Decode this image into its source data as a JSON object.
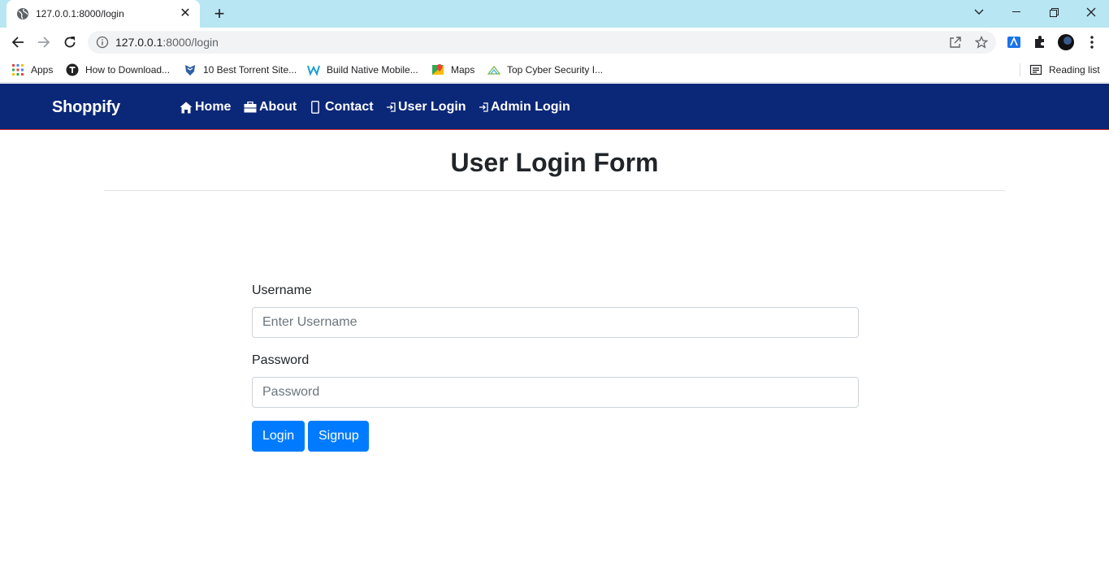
{
  "browser": {
    "tab_title": "127.0.0.1:8000/login",
    "url_host": "127.0.0.1",
    "url_rest": ":8000/login",
    "bookmarks": [
      {
        "label": "Apps"
      },
      {
        "label": "How to Download..."
      },
      {
        "label": "10 Best Torrent Site..."
      },
      {
        "label": "Build Native Mobile..."
      },
      {
        "label": "Maps"
      },
      {
        "label": "Top Cyber Security I..."
      }
    ],
    "reading_list": "Reading list"
  },
  "navbar": {
    "brand": "Shoppify",
    "links": [
      {
        "label": "Home",
        "icon": "home-icon"
      },
      {
        "label": "About",
        "icon": "briefcase-icon"
      },
      {
        "label": "Contact",
        "icon": "phone-icon"
      },
      {
        "label": "User Login",
        "icon": "sign-in-icon"
      },
      {
        "label": "Admin Login",
        "icon": "sign-in-icon"
      }
    ],
    "color": "#0b2777"
  },
  "page": {
    "heading": "User Login Form",
    "username_label": "Username",
    "username_placeholder": "Enter Username",
    "password_label": "Password",
    "password_placeholder": "Password",
    "login_button": "Login",
    "signup_button": "Signup",
    "button_color": "#007bff"
  }
}
